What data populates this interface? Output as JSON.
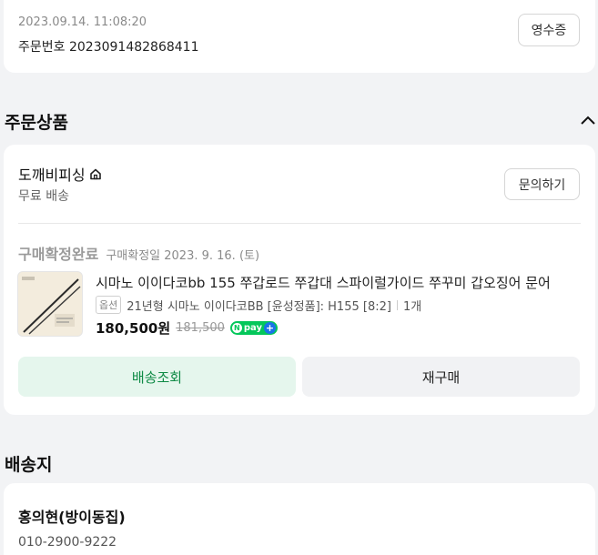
{
  "order": {
    "datetime": "2023.09.14. 11:08:20",
    "number_label": "주문번호",
    "number": "2023091482868411",
    "receipt_button": "영수증"
  },
  "sections": {
    "products_title": "주문상품",
    "address_title": "배송지"
  },
  "store": {
    "name": "도깨비피싱",
    "home_icon": "home-icon",
    "shipping": "무료 배송",
    "inquiry_button": "문의하기"
  },
  "item": {
    "status": "구매확정완료",
    "status_date": "구매확정일 2023. 9. 16. (토)",
    "name": "시마노 이이다코bb 155 쭈갑로드 쭈갑대 스파이럴가이드 쭈꾸미 갑오징어 문어",
    "option_badge": "옵션",
    "option": "21년형 시마노 이이다코BB [윤성정품]: H155 [8:2]",
    "quantity": "1개",
    "price": "180,500원",
    "original_price": "181,500",
    "npay_label": "pay",
    "track_button": "배송조회",
    "rebuy_button": "재구매"
  },
  "delivery": {
    "recipient": "홍의현(방이동집)",
    "phone": "010-2900-9222"
  },
  "colors": {
    "accent_green": "#0e8a45",
    "track_bg": "#e5f6ed",
    "npay_green": "#03c75a"
  }
}
